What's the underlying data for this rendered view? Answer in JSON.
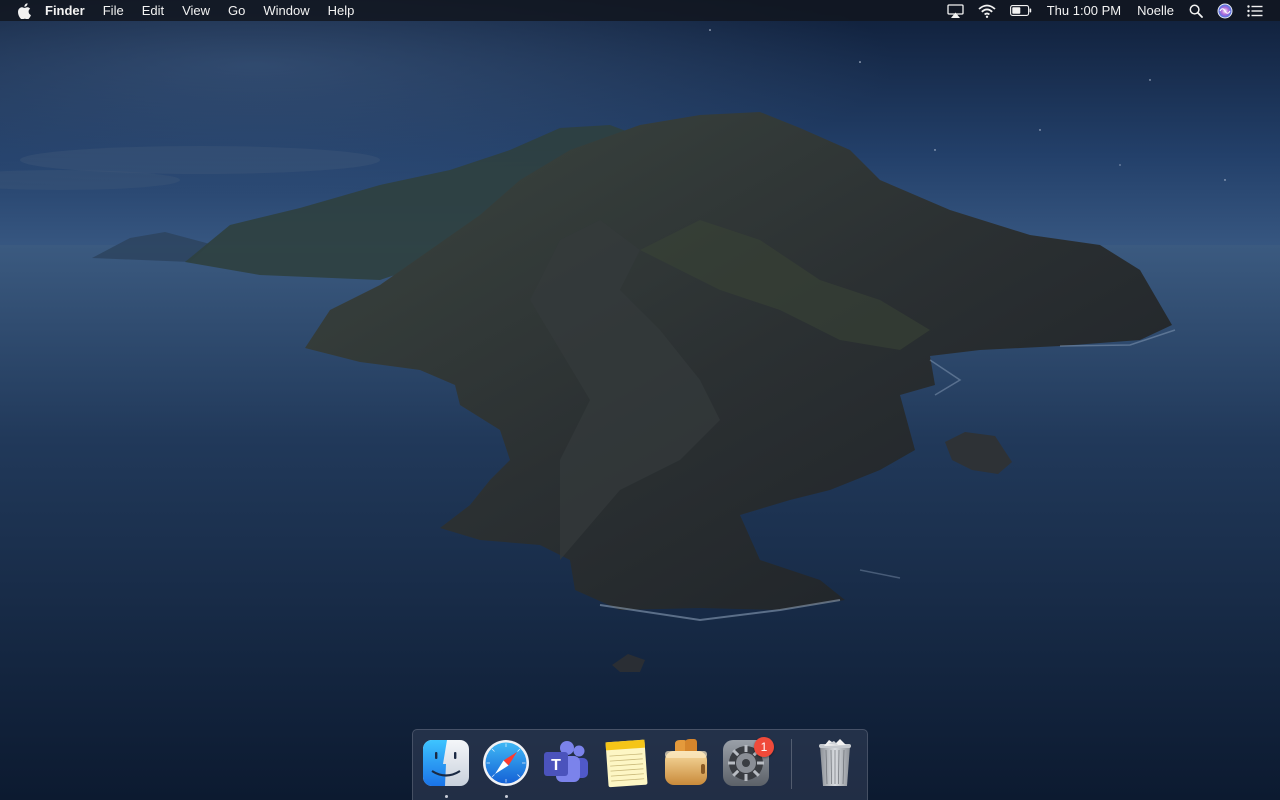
{
  "menubar": {
    "app_name": "Finder",
    "menus": [
      "File",
      "Edit",
      "View",
      "Go",
      "Window",
      "Help"
    ],
    "clock": "Thu 1:00 PM",
    "user": "Noelle",
    "status_icons": [
      "airplay-icon",
      "wifi-icon",
      "battery-icon"
    ],
    "right_icons": [
      "spotlight-search-icon",
      "siri-icon",
      "notification-center-icon"
    ]
  },
  "dock": {
    "apps": [
      {
        "name": "finder",
        "icon": "finder-icon",
        "running": true
      },
      {
        "name": "safari",
        "icon": "safari-icon",
        "running": true
      },
      {
        "name": "microsoft-teams",
        "icon": "teams-icon",
        "running": false,
        "icon_letter": "T"
      },
      {
        "name": "notes",
        "icon": "notes-icon",
        "running": false
      },
      {
        "name": "toaster",
        "icon": "toaster-icon",
        "running": false
      },
      {
        "name": "system-preferences",
        "icon": "system-preferences-icon",
        "running": false,
        "badge": "1"
      }
    ],
    "trash": {
      "icon": "trash-full-icon"
    }
  },
  "colors": {
    "badge": "#f04a3a",
    "menubar_bg": "#12161f",
    "sea": "#213a5c",
    "sky": "#1d3456"
  }
}
